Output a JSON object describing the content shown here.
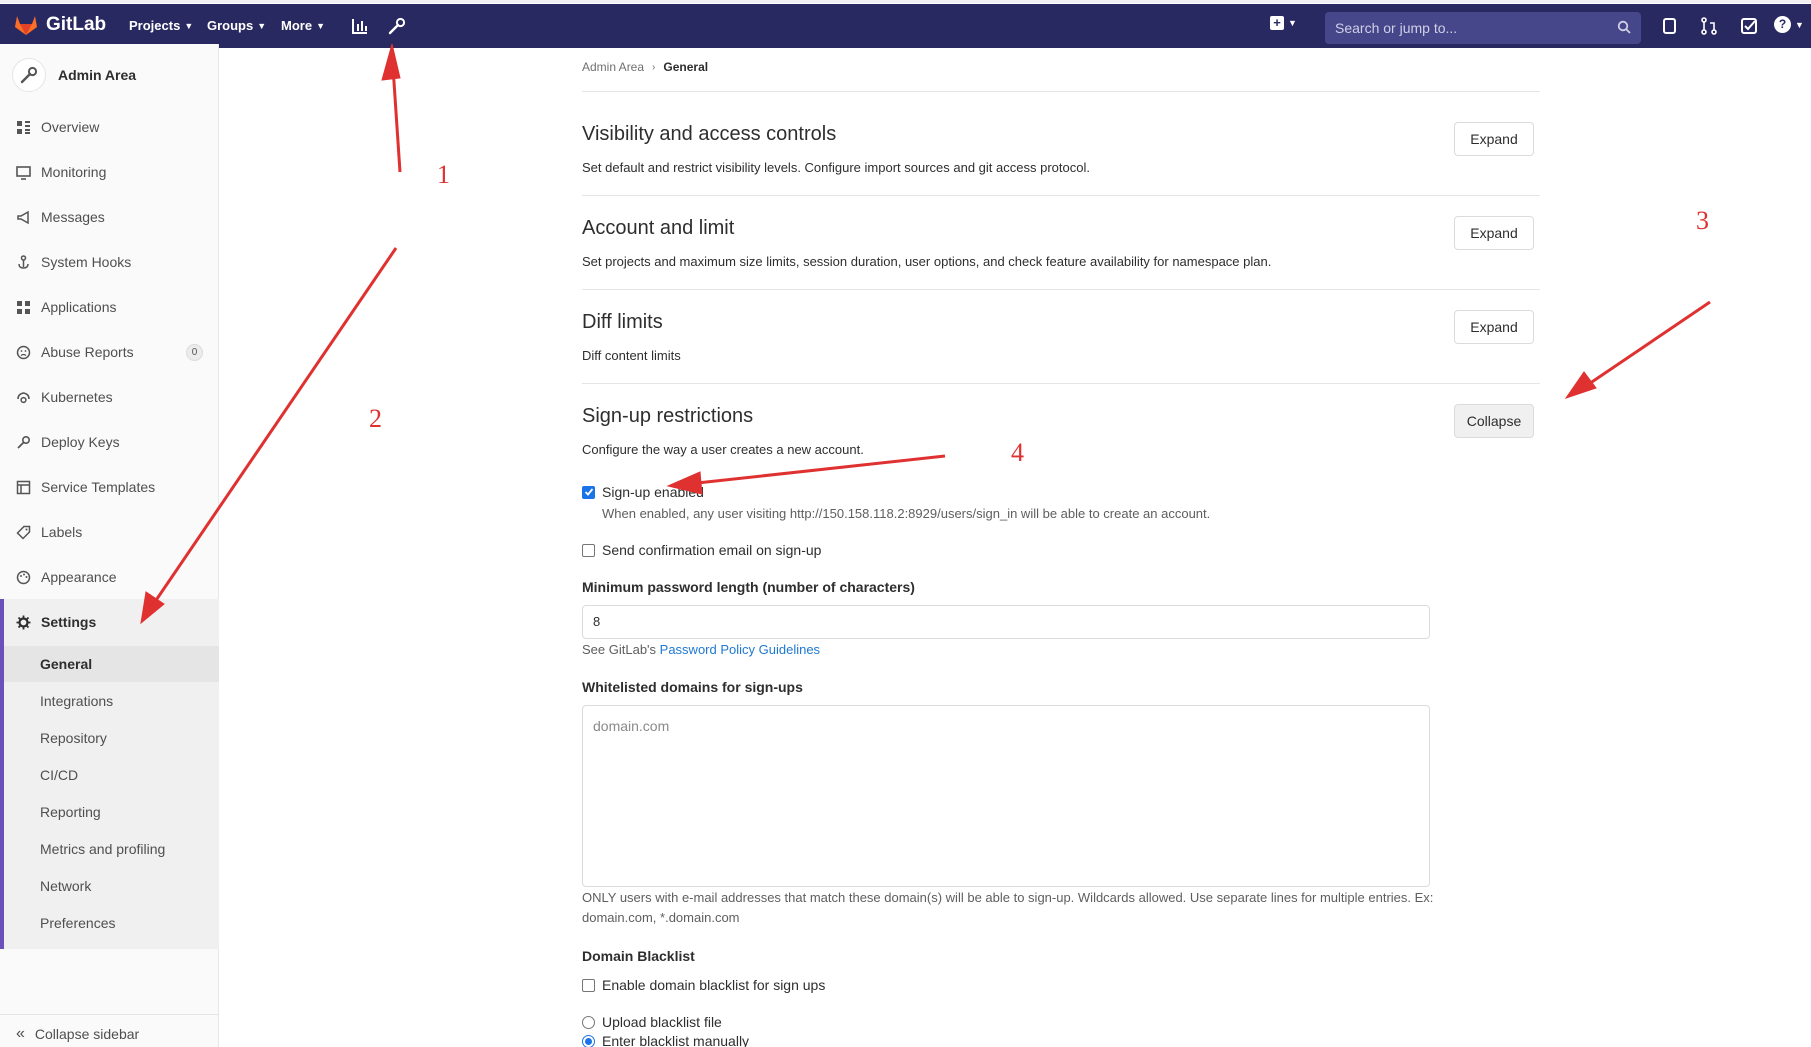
{
  "navbar": {
    "brand": "GitLab",
    "projects": "Projects",
    "groups": "Groups",
    "more": "More",
    "search_placeholder": "Search or jump to...",
    "colors": {
      "bg": "#292961",
      "search": "#46468a"
    },
    "icons": [
      "chart-icon",
      "wrench-icon",
      "plus-icon",
      "issues-icon",
      "merge-request-icon",
      "todo-icon",
      "help-icon"
    ]
  },
  "sidebar": {
    "title": "Admin Area",
    "items": [
      {
        "label": "Overview",
        "icon": "grid-icon"
      },
      {
        "label": "Monitoring",
        "icon": "monitor-icon"
      },
      {
        "label": "Messages",
        "icon": "megaphone-icon"
      },
      {
        "label": "System Hooks",
        "icon": "hook-icon"
      },
      {
        "label": "Applications",
        "icon": "apps-icon"
      },
      {
        "label": "Abuse Reports",
        "icon": "abuse-icon",
        "badge": "0"
      },
      {
        "label": "Kubernetes",
        "icon": "kubernetes-icon"
      },
      {
        "label": "Deploy Keys",
        "icon": "key-icon"
      },
      {
        "label": "Service Templates",
        "icon": "template-icon"
      },
      {
        "label": "Labels",
        "icon": "label-icon"
      },
      {
        "label": "Appearance",
        "icon": "palette-icon"
      },
      {
        "label": "Settings",
        "icon": "gear-icon"
      }
    ],
    "settings_sub": [
      "General",
      "Integrations",
      "Repository",
      "CI/CD",
      "Reporting",
      "Metrics and profiling",
      "Network",
      "Preferences"
    ],
    "collapse": "Collapse sidebar"
  },
  "breadcrumb": {
    "root": "Admin Area",
    "current": "General"
  },
  "sections": [
    {
      "title": "Visibility and access controls",
      "desc": "Set default and restrict visibility levels. Configure import sources and git access protocol.",
      "button": "Expand"
    },
    {
      "title": "Account and limit",
      "desc": "Set projects and maximum size limits, session duration, user options, and check feature availability for namespace plan.",
      "button": "Expand"
    },
    {
      "title": "Diff limits",
      "desc": "Diff content limits",
      "button": "Expand"
    },
    {
      "title": "Sign-up restrictions",
      "desc": "Configure the way a user creates a new account.",
      "button": "Collapse"
    }
  ],
  "signup": {
    "enabled_label": "Sign-up enabled",
    "enabled_checked": true,
    "enabled_help": "When enabled, any user visiting http://150.158.118.2:8929/users/sign_in will be able to create an account.",
    "confirm_label": "Send confirmation email on sign-up",
    "confirm_checked": false,
    "min_pw_label": "Minimum password length (number of characters)",
    "min_pw_value": "8",
    "pw_help_prefix": "See GitLab's",
    "pw_help_link": "Password Policy Guidelines",
    "whitelist_label": "Whitelisted domains for sign-ups",
    "whitelist_placeholder": "domain.com",
    "whitelist_note": "ONLY users with e-mail addresses that match these domain(s) will be able to sign-up. Wildcards allowed. Use separate lines for multiple entries. Ex: domain.com, *.domain.com",
    "blacklist_heading": "Domain Blacklist",
    "blacklist_enable_label": "Enable domain blacklist for sign ups",
    "upload_label": "Upload blacklist file",
    "manual_label": "Enter blacklist manually"
  },
  "annotations": {
    "n1": "1",
    "n2": "2",
    "n3": "3",
    "n4": "4",
    "color": "#e03131"
  }
}
